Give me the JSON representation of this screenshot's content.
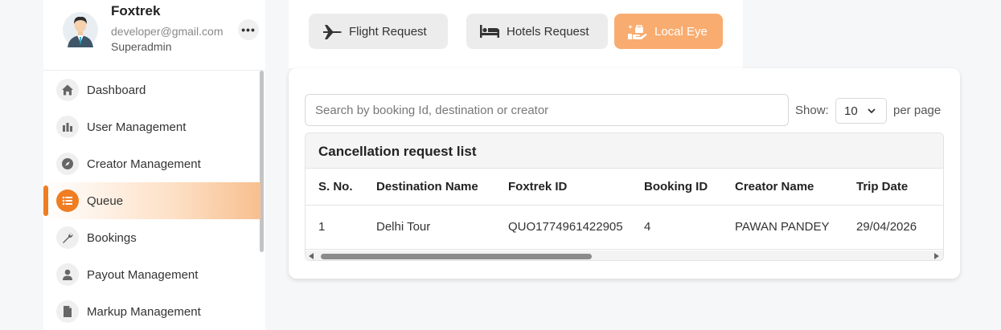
{
  "profile": {
    "name": "Foxtrek",
    "email": "developer@gmail.com",
    "role": "Superadmin",
    "more": "•••"
  },
  "sidebar": {
    "items": [
      {
        "label": "Dashboard",
        "icon": "home-icon"
      },
      {
        "label": "User Management",
        "icon": "bar-chart-icon"
      },
      {
        "label": "Creator Management",
        "icon": "compass-icon"
      },
      {
        "label": "Queue",
        "icon": "list-icon",
        "active": true
      },
      {
        "label": "Bookings",
        "icon": "wrench-icon"
      },
      {
        "label": "Payout Management",
        "icon": "person-icon"
      },
      {
        "label": "Markup Management",
        "icon": "document-icon"
      }
    ]
  },
  "tabs": [
    {
      "label": "Flight Request",
      "icon": "airplane-icon"
    },
    {
      "label": "Hotels Request",
      "icon": "bed-icon"
    },
    {
      "label": "Local Eye",
      "icon": "local-eye-icon",
      "active": true
    }
  ],
  "search": {
    "placeholder": "Search by booking Id, destination or creator",
    "value": ""
  },
  "pagination": {
    "show_label": "Show:",
    "per_page_value": "10",
    "per_page_label": "per page"
  },
  "table": {
    "title": "Cancellation request list",
    "columns": [
      "S. No.",
      "Destination Name",
      "Foxtrek ID",
      "Booking ID",
      "Creator Name",
      "Trip Date"
    ],
    "rows": [
      [
        "1",
        "Delhi Tour",
        "QUO1774961422905",
        "4",
        "PAWAN PANDEY",
        "29/04/2026"
      ]
    ]
  },
  "colors": {
    "accent": "#f07d22",
    "active_tab": "#f9ac6f",
    "background": "#f6f7f9"
  }
}
